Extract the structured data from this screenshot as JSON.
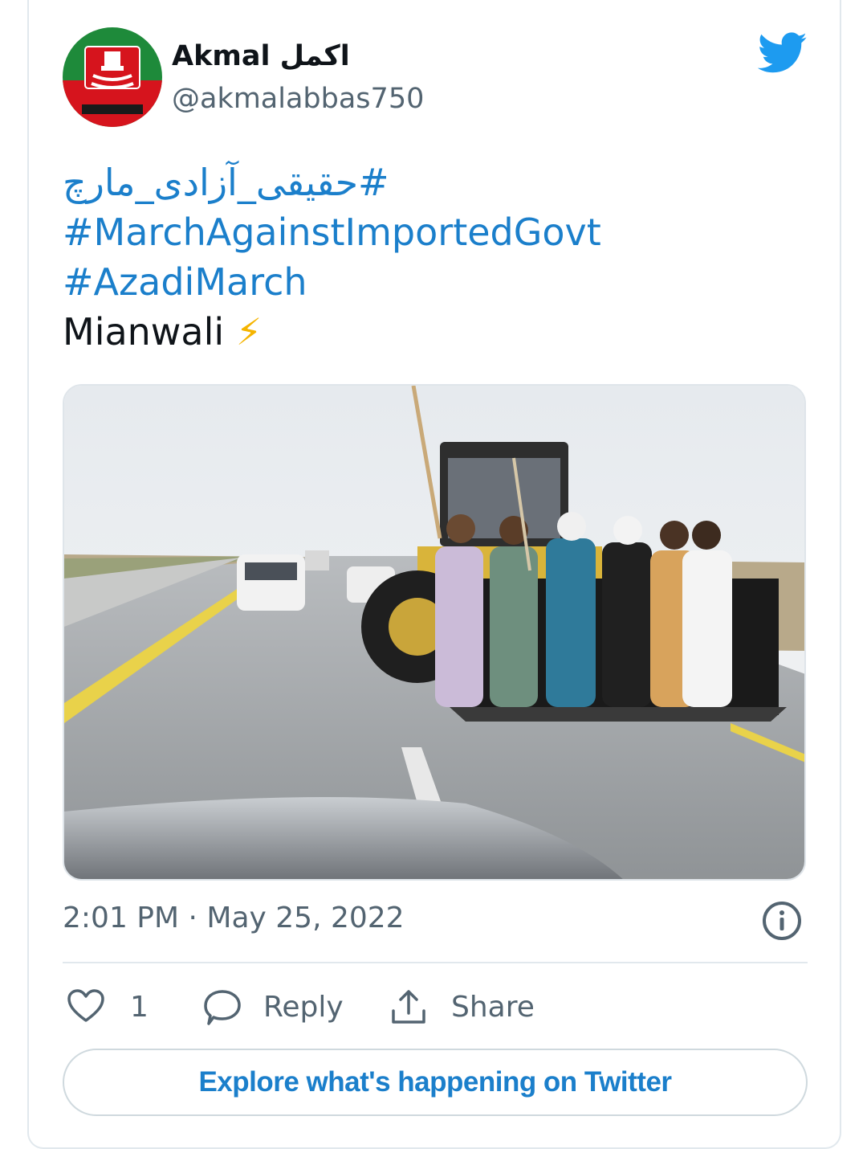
{
  "author": {
    "name": "Akmal",
    "name_urdu": "اکمل",
    "handle": "@akmalabbas750",
    "avatar_icon": "party-flag-fist-avatar"
  },
  "tweet": {
    "lines": [
      {
        "text": "#حقیقی_آزادی_مارچ",
        "type": "hashtag"
      },
      {
        "text": "#MarchAgainstImportedGovt",
        "type": "hashtag"
      },
      {
        "text": "#AzadiMarch",
        "type": "hashtag"
      },
      {
        "text": "Mianwali",
        "type": "plain"
      }
    ],
    "emoji": "⚡"
  },
  "timestamp": "2:01 PM · May 25, 2022",
  "actions": {
    "like_count": "1",
    "reply_label": "Reply",
    "share_label": "Share"
  },
  "explore_label": "Explore what's happening on Twitter",
  "colors": {
    "link": "#1b7fcb",
    "twitter_blue": "#1d9bf0",
    "muted": "#536471"
  }
}
